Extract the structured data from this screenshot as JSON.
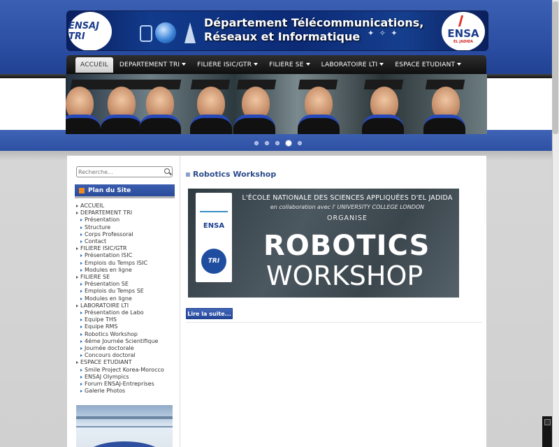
{
  "header": {
    "title_line1": "Département Télécommunications,",
    "title_line2": "Réseaux et Informatique",
    "logo_left_text": "ENSAJ TRI",
    "logo_right_text": "ENSA",
    "logo_right_sub": "EL JADIDA"
  },
  "nav": {
    "items": [
      {
        "label": "ACCUEIL",
        "active": true,
        "dropdown": false
      },
      {
        "label": "DEPARTEMENT TRI",
        "active": false,
        "dropdown": true
      },
      {
        "label": "FILIERE ISIC/GTR",
        "active": false,
        "dropdown": true
      },
      {
        "label": "FILIERE SE",
        "active": false,
        "dropdown": true
      },
      {
        "label": "LABORATOIRE LTI",
        "active": false,
        "dropdown": true
      },
      {
        "label": "ESPACE ETUDIANT",
        "active": false,
        "dropdown": true
      }
    ]
  },
  "slideshow": {
    "dot_count": 5,
    "active_dot": 4
  },
  "search": {
    "placeholder": "Recherche..."
  },
  "sidebar": {
    "plan_title": "Plan du Site",
    "menu": [
      {
        "label": "ACCUEIL",
        "level": 0
      },
      {
        "label": "DEPARTEMENT TRI",
        "level": 0
      },
      {
        "label": "Présentation",
        "level": 1
      },
      {
        "label": "Structure",
        "level": 1
      },
      {
        "label": "Corps Professoral",
        "level": 1
      },
      {
        "label": "Contact",
        "level": 1
      },
      {
        "label": "FILIERE ISIC/GTR",
        "level": 0
      },
      {
        "label": "Présentation ISIC",
        "level": 1
      },
      {
        "label": "Emplois du Temps ISIC",
        "level": 1
      },
      {
        "label": "Modules en ligne",
        "level": 1
      },
      {
        "label": "FILIERE SE",
        "level": 0
      },
      {
        "label": "Présentation SE",
        "level": 1
      },
      {
        "label": "Emplois du Temps SE",
        "level": 1
      },
      {
        "label": "Modules en ligne",
        "level": 1
      },
      {
        "label": "LABORATOIRE LTI",
        "level": 0
      },
      {
        "label": "Présentation de Labo",
        "level": 1
      },
      {
        "label": "Equipe THS",
        "level": 1
      },
      {
        "label": "Equipe RMS",
        "level": 1
      },
      {
        "label": "Robotics Workshop",
        "level": 1
      },
      {
        "label": "4éme Journée Scientifique",
        "level": 1
      },
      {
        "label": "Journée doctorale",
        "level": 1
      },
      {
        "label": "Concours doctoral",
        "level": 1
      },
      {
        "label": "ESPACE ETUDIANT",
        "level": 0
      },
      {
        "label": "Smile Project Korea-Morocco",
        "level": 1
      },
      {
        "label": "ENSAJ Olympics",
        "level": 1
      },
      {
        "label": "Forum ENSAJ-Entreprises",
        "level": 1
      },
      {
        "label": "Galerie Photos",
        "level": 1
      }
    ]
  },
  "article": {
    "title": "Robotics Workshop",
    "poster": {
      "line1": "L'ÉCOLE NATIONALE DES SCIENCES APPLIQUÉES D'EL JADIDA",
      "line2": "en collaboration avec l' UNIVERSITY COLLEGE LONDON",
      "line3": "ORGANISE",
      "big1": "ROBOTICS",
      "big2": "WORKSHOP",
      "side_ensa": "ENSA"
    },
    "read_more": "Lire la suite..."
  }
}
